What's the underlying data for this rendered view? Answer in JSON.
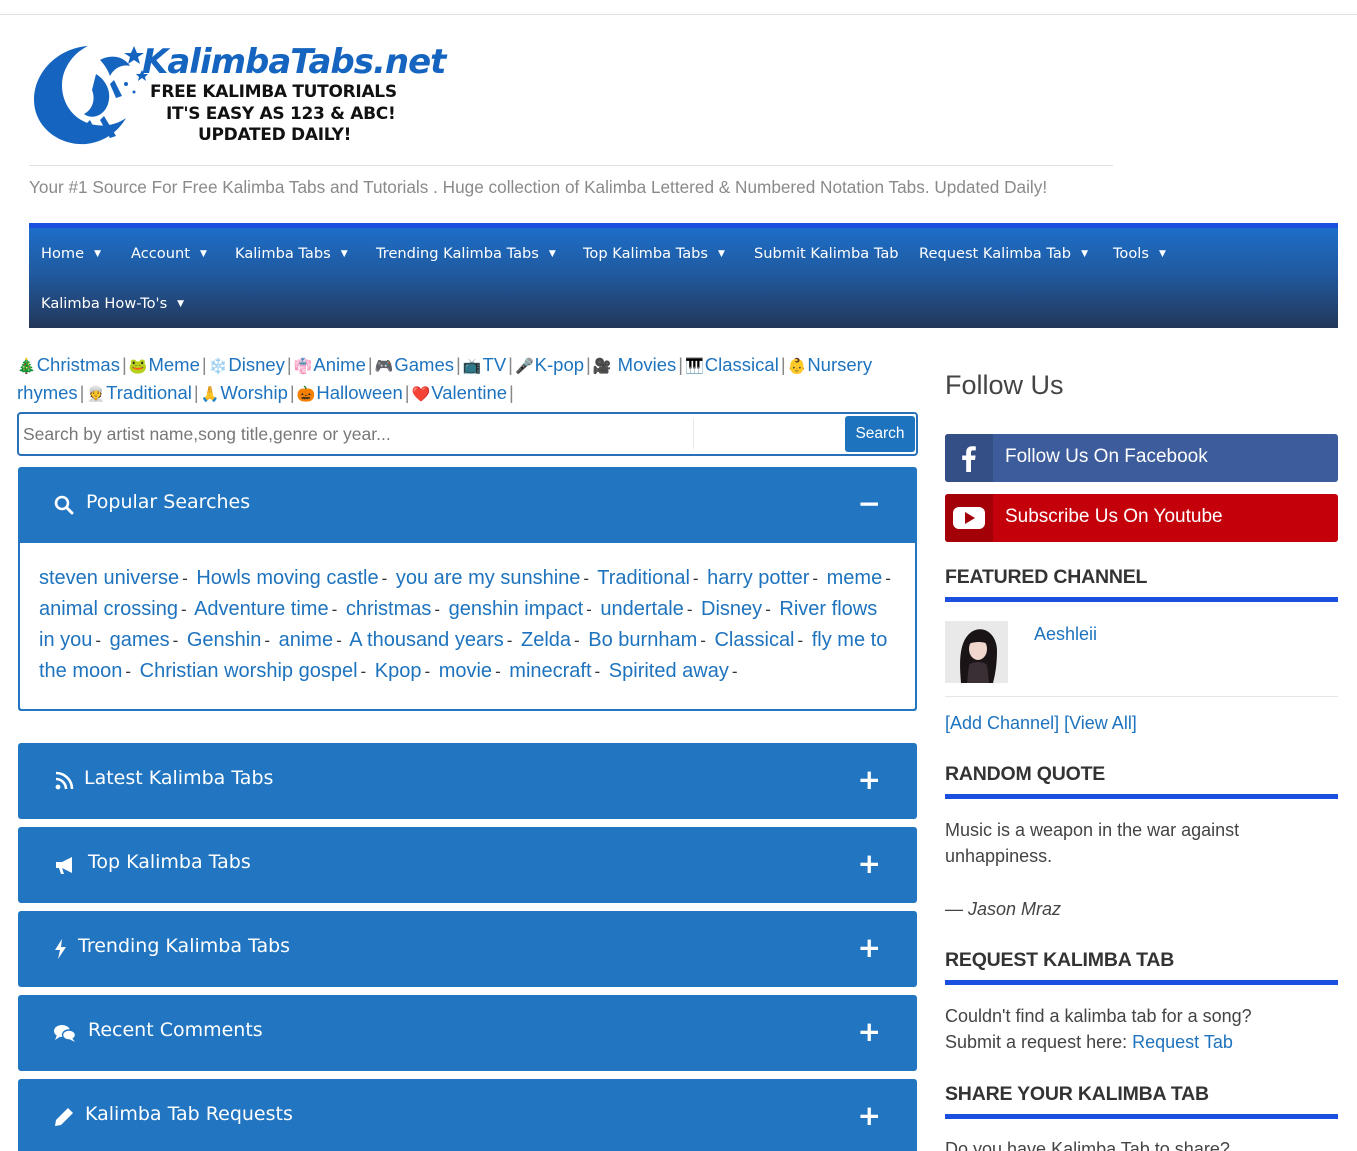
{
  "logo": {
    "title": "KalimbaTabs.net",
    "line1": "FREE KALIMBA TUTORIALS",
    "line2": "IT'S EASY AS 123 & ABC!",
    "line3": "UPDATED DAILY!"
  },
  "tagline": "Your #1 Source For Free Kalimba Tabs and Tutorials . Huge collection of Kalimba Lettered & Numbered Notation Tabs. Updated Daily!",
  "nav": {
    "items": [
      {
        "label": "Home",
        "caret": "▼"
      },
      {
        "label": "Account",
        "caret": "▼"
      },
      {
        "label": "Kalimba Tabs",
        "caret": "▼"
      },
      {
        "label": "Trending Kalimba Tabs",
        "caret": "▼"
      },
      {
        "label": "Top Kalimba Tabs",
        "caret": "▼"
      },
      {
        "label": "Submit Kalimba Tab",
        "caret": ""
      },
      {
        "label": "Request Kalimba Tab",
        "caret": "▼"
      },
      {
        "label": "Tools",
        "caret": "▼"
      },
      {
        "label": "Kalimba How-To's",
        "caret": "▼"
      }
    ]
  },
  "categories": [
    {
      "emoji": "🎄",
      "label": "Christmas"
    },
    {
      "emoji": "🐸",
      "label": "Meme"
    },
    {
      "emoji": "❄️",
      "label": "Disney"
    },
    {
      "emoji": "👘",
      "label": "Anime"
    },
    {
      "emoji": "🎮",
      "label": "Games"
    },
    {
      "emoji": "📺",
      "label": "TV"
    },
    {
      "emoji": "🎤",
      "label": "K-pop"
    },
    {
      "emoji": "🎥",
      "label": " Movies"
    },
    {
      "emoji": "🎹",
      "label": "Classical"
    },
    {
      "emoji": "👶",
      "label": "Nursery rhymes"
    },
    {
      "emoji": "👳",
      "label": "Traditional"
    },
    {
      "emoji": "🙏",
      "label": "Worship"
    },
    {
      "emoji": "🎃",
      "label": "Halloween"
    },
    {
      "emoji": "❤️",
      "label": "Valentine"
    }
  ],
  "category_separator": "|",
  "search": {
    "placeholder": "Search by artist name,song title,genre or year...",
    "button_label": "Search"
  },
  "popular": {
    "title": "Popular Searches",
    "toggle": "−",
    "separator": "-",
    "terms": [
      "steven universe",
      "Howls moving castle",
      "you are my sunshine",
      "Traditional",
      "harry potter",
      "meme",
      "animal crossing",
      "Adventure time",
      "christmas",
      "genshin impact",
      "undertale",
      "Disney",
      "River flows in you",
      "games",
      "Genshin",
      "anime",
      "A thousand years",
      "Zelda",
      "Bo burnham",
      "Classical",
      "fly me to the moon",
      "Christian worship gospel",
      "Kpop",
      "movie",
      "minecraft",
      "Spirited away"
    ]
  },
  "panels": [
    {
      "title": "Latest Kalimba Tabs",
      "icon": "rss-icon",
      "toggle": "+"
    },
    {
      "title": "Top Kalimba Tabs",
      "icon": "bullhorn-icon",
      "toggle": "+"
    },
    {
      "title": "Trending Kalimba Tabs",
      "icon": "bolt-icon",
      "toggle": "+"
    },
    {
      "title": "Recent Comments",
      "icon": "comments-icon",
      "toggle": "+"
    },
    {
      "title": "Kalimba Tab Requests",
      "icon": "pencil-icon",
      "toggle": "+"
    }
  ],
  "sidebar": {
    "follow_title": "Follow Us",
    "facebook_label": "Follow Us On Facebook",
    "youtube_label": "Subscribe Us On Youtube",
    "featured_title": "FEATURED CHANNEL",
    "channel_name": "Aeshleii",
    "add_channel": "[Add Channel]",
    "view_all": "[View All]",
    "quote_title": "RANDOM QUOTE",
    "quote_text": "Music is a weapon in the war against unhappiness.",
    "quote_author": "— Jason Mraz",
    "request_title": "REQUEST KALIMBA TAB",
    "request_text": "Couldn't find a kalimba tab for a song? Submit a request here:",
    "request_link": "Request Tab",
    "share_title": "SHARE YOUR KALIMBA TAB",
    "share_text": "Do you have Kalimba Tab to share?"
  },
  "colors": {
    "accent": "#1e73be",
    "panel": "#2175c1",
    "nav_top": "#1a4fe0",
    "facebook": "#3d5c9b",
    "youtube": "#c4000a"
  }
}
